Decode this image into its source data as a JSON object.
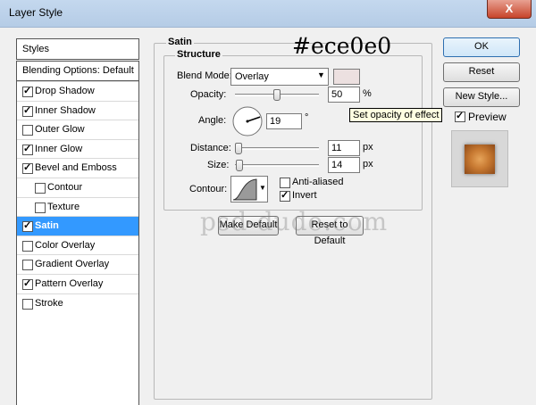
{
  "window": {
    "title": "Layer Style",
    "close_label": "X"
  },
  "styles_header": "Styles",
  "styles": [
    {
      "label": "Blending Options: Default",
      "checkbox": false,
      "checked": false,
      "selected": false
    },
    {
      "label": "Drop Shadow",
      "checkbox": true,
      "checked": true,
      "selected": false
    },
    {
      "label": "Inner Shadow",
      "checkbox": true,
      "checked": true,
      "selected": false
    },
    {
      "label": "Outer Glow",
      "checkbox": true,
      "checked": false,
      "selected": false
    },
    {
      "label": "Inner Glow",
      "checkbox": true,
      "checked": true,
      "selected": false
    },
    {
      "label": "Bevel and Emboss",
      "checkbox": true,
      "checked": true,
      "selected": false
    },
    {
      "label": "Contour",
      "checkbox": true,
      "checked": false,
      "selected": false,
      "indent": true
    },
    {
      "label": "Texture",
      "checkbox": true,
      "checked": false,
      "selected": false,
      "indent": true
    },
    {
      "label": "Satin",
      "checkbox": true,
      "checked": true,
      "selected": true
    },
    {
      "label": "Color Overlay",
      "checkbox": true,
      "checked": false,
      "selected": false
    },
    {
      "label": "Gradient Overlay",
      "checkbox": true,
      "checked": false,
      "selected": false
    },
    {
      "label": "Pattern Overlay",
      "checkbox": true,
      "checked": true,
      "selected": false
    },
    {
      "label": "Stroke",
      "checkbox": true,
      "checked": false,
      "selected": false
    }
  ],
  "satin": {
    "title": "Satin",
    "structure_title": "Structure",
    "blend_mode_label": "Blend Mode:",
    "blend_mode_value": "Overlay",
    "color_swatch": "#ece0e0",
    "opacity_label": "Opacity:",
    "opacity_value": "50",
    "opacity_unit": "%",
    "opacity_level": 50,
    "angle_label": "Angle:",
    "angle_value": "19",
    "angle_unit": "°",
    "distance_label": "Distance:",
    "distance_value": "11",
    "distance_unit": "px",
    "distance_level": 11,
    "size_label": "Size:",
    "size_value": "14",
    "size_unit": "px",
    "size_level": 14,
    "contour_label": "Contour:",
    "anti_aliased_label": "Anti-aliased",
    "anti_aliased_checked": false,
    "invert_label": "Invert",
    "invert_checked": true,
    "make_default_label": "Make Default",
    "reset_default_label": "Reset to Default"
  },
  "tooltip": "Set opacity of effect",
  "annotation_hex": "#ece0e0",
  "watermark": "psd-dude.com",
  "buttons": {
    "ok": "OK",
    "reset": "Reset",
    "new_style": "New Style...",
    "preview_label": "Preview",
    "preview_checked": true
  },
  "colors": {
    "selection": "#3399ff",
    "title_bar": "#c4d8ee",
    "close_button": "#c7442a"
  }
}
